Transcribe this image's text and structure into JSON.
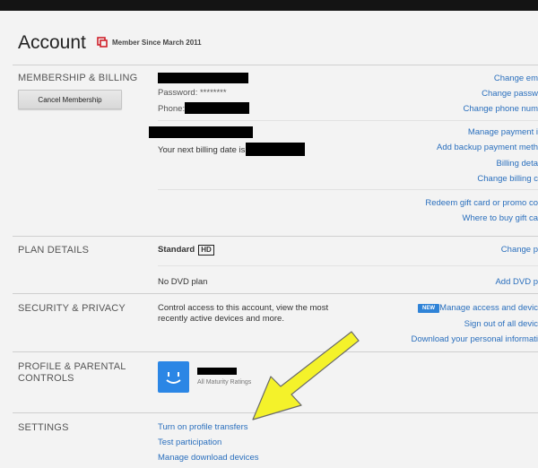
{
  "header": {
    "title": "Account",
    "member_since": "Member Since March 2011"
  },
  "membership": {
    "section_label": "MEMBERSHIP & BILLING",
    "cancel_button": "Cancel Membership",
    "password_label": "Password: ********",
    "phone_label": "Phone:",
    "billing_date_text": "Your next billing date is",
    "links": {
      "change_email": "Change em",
      "change_password": "Change passw",
      "change_phone": "Change phone num",
      "manage_payment": "Manage payment i",
      "add_backup_payment": "Add backup payment meth",
      "billing_details": "Billing deta",
      "change_billing": "Change billing c",
      "redeem_gift": "Redeem gift card or promo co",
      "where_to_buy": "Where to buy gift ca"
    }
  },
  "plan": {
    "section_label": "PLAN DETAILS",
    "plan_name": "Standard",
    "plan_badge": "HD",
    "dvd_plan": "No DVD plan",
    "change_plan": "Change p",
    "add_dvd": "Add DVD p"
  },
  "security": {
    "section_label": "SECURITY & PRIVACY",
    "description_line1": "Control access to this account, view the most",
    "description_line2": "recently active devices and more.",
    "new_badge": "NEW",
    "manage_access": "Manage access and devic",
    "sign_out_all": "Sign out of all devic",
    "download_info": "Download your personal informati"
  },
  "profile": {
    "section_label_line1": "PROFILE & PARENTAL",
    "section_label_line2": "CONTROLS",
    "maturity": "All Maturity Ratings"
  },
  "settings": {
    "section_label": "SETTINGS",
    "profile_transfers": "Turn on profile transfers",
    "test_participation": "Test participation",
    "manage_download_devices": "Manage download devices"
  },
  "colors": {
    "link": "#2a6fbd",
    "avatar": "#2b86e5",
    "badge": "#2f83d7",
    "arrow": "#f4f22a",
    "background": "#f3f3f3"
  }
}
